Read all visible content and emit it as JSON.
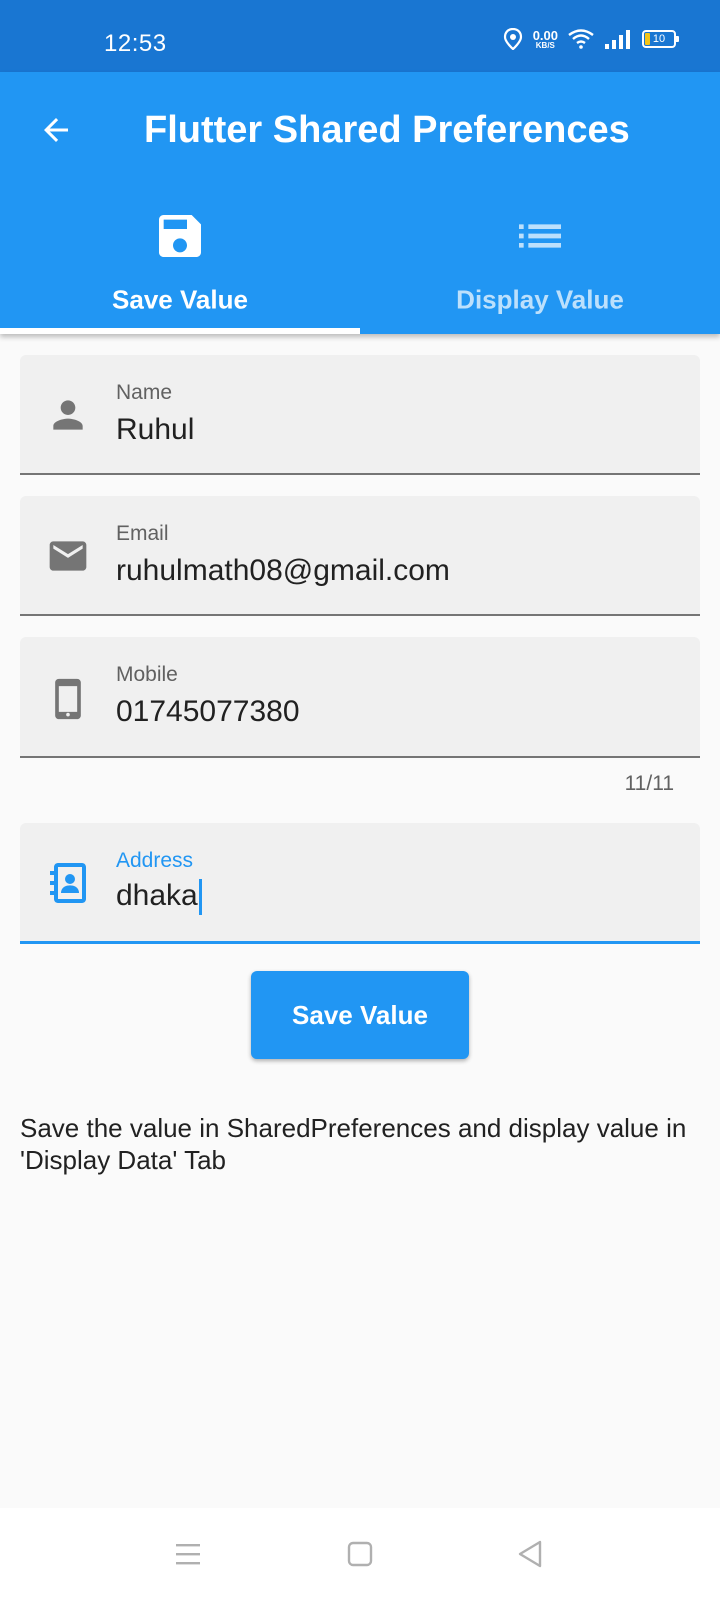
{
  "status_bar": {
    "time": "12:53",
    "net_speed": "0.00",
    "net_unit": "KB/S",
    "battery": "10"
  },
  "app_bar": {
    "title": "Flutter Shared Preferences",
    "background": "#2196f3"
  },
  "tabs": [
    {
      "label": "Save Value",
      "icon": "save-icon",
      "selected": true
    },
    {
      "label": "Display Value",
      "icon": "list-icon",
      "selected": false
    }
  ],
  "form": {
    "name": {
      "label": "Name",
      "value": "Ruhul",
      "icon": "person-icon"
    },
    "email": {
      "label": "Email",
      "value": "ruhulmath08@gmail.com",
      "icon": "email-icon"
    },
    "mobile": {
      "label": "Mobile",
      "value": "01745077380",
      "icon": "phone-icon",
      "counter": "11/11"
    },
    "address": {
      "label": "Address",
      "value": "dhaka",
      "icon": "contact-card-icon"
    }
  },
  "save_button": "Save Value",
  "description": "Save the value in SharedPreferences and display value in 'Display Data' Tab",
  "colors": {
    "accent": "#2196f3",
    "status_bar": "#1976d2"
  }
}
